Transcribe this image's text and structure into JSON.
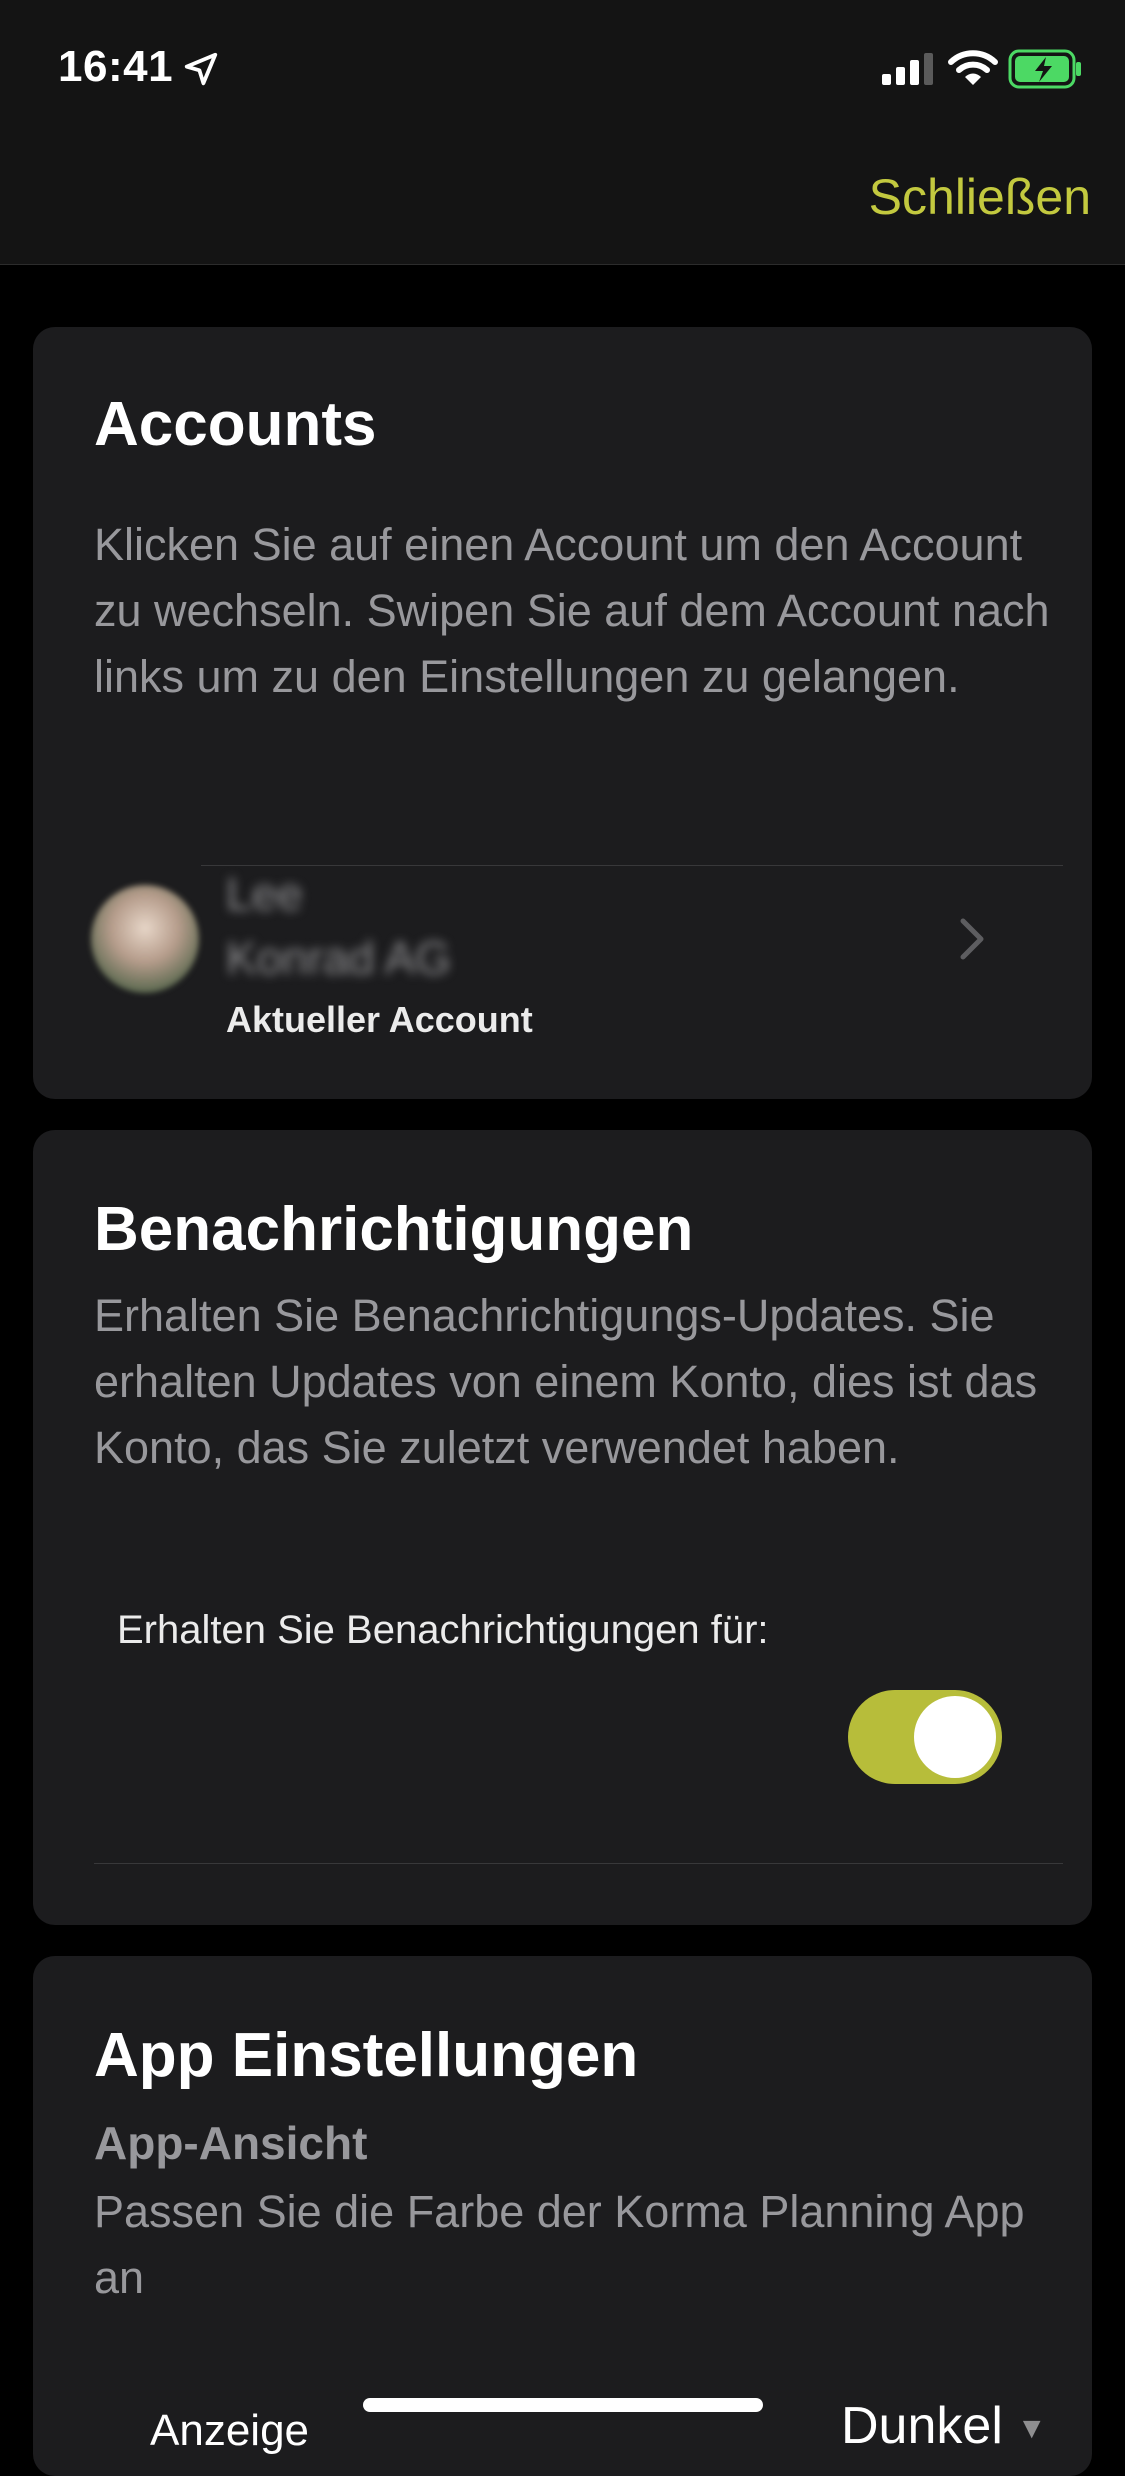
{
  "status_bar": {
    "time": "16:41"
  },
  "nav": {
    "close_label": "Schließen"
  },
  "colors": {
    "accent": "#c3c93f",
    "toggle_on": "#b7bd3a",
    "card_bg": "#1c1c1e"
  },
  "accounts": {
    "title": "Accounts",
    "description": "Klicken Sie auf einen Account um den Account zu wechseln. Swipen Sie auf dem Account nach links um zu den Einstellungen zu gelangen.",
    "items": [
      {
        "name": "Lee",
        "company": "Konrad AG",
        "status": "Aktueller Account"
      }
    ]
  },
  "notifications": {
    "title": "Benachrichtigungen",
    "description": "Erhalten Sie Benachrichtigungs-Updates. Sie erhalten Updates von einem Konto, dies ist das Konto, das Sie zuletzt verwendet haben.",
    "toggle_label": "Erhalten Sie Benachrichtigungen für:",
    "toggle_on": true
  },
  "app_settings": {
    "title": "App Einstellungen",
    "view_heading": "App-Ansicht",
    "view_description": "Passen Sie die Farbe der Korma Planning App an",
    "display_label": "Anzeige",
    "display_value": "Dunkel"
  }
}
